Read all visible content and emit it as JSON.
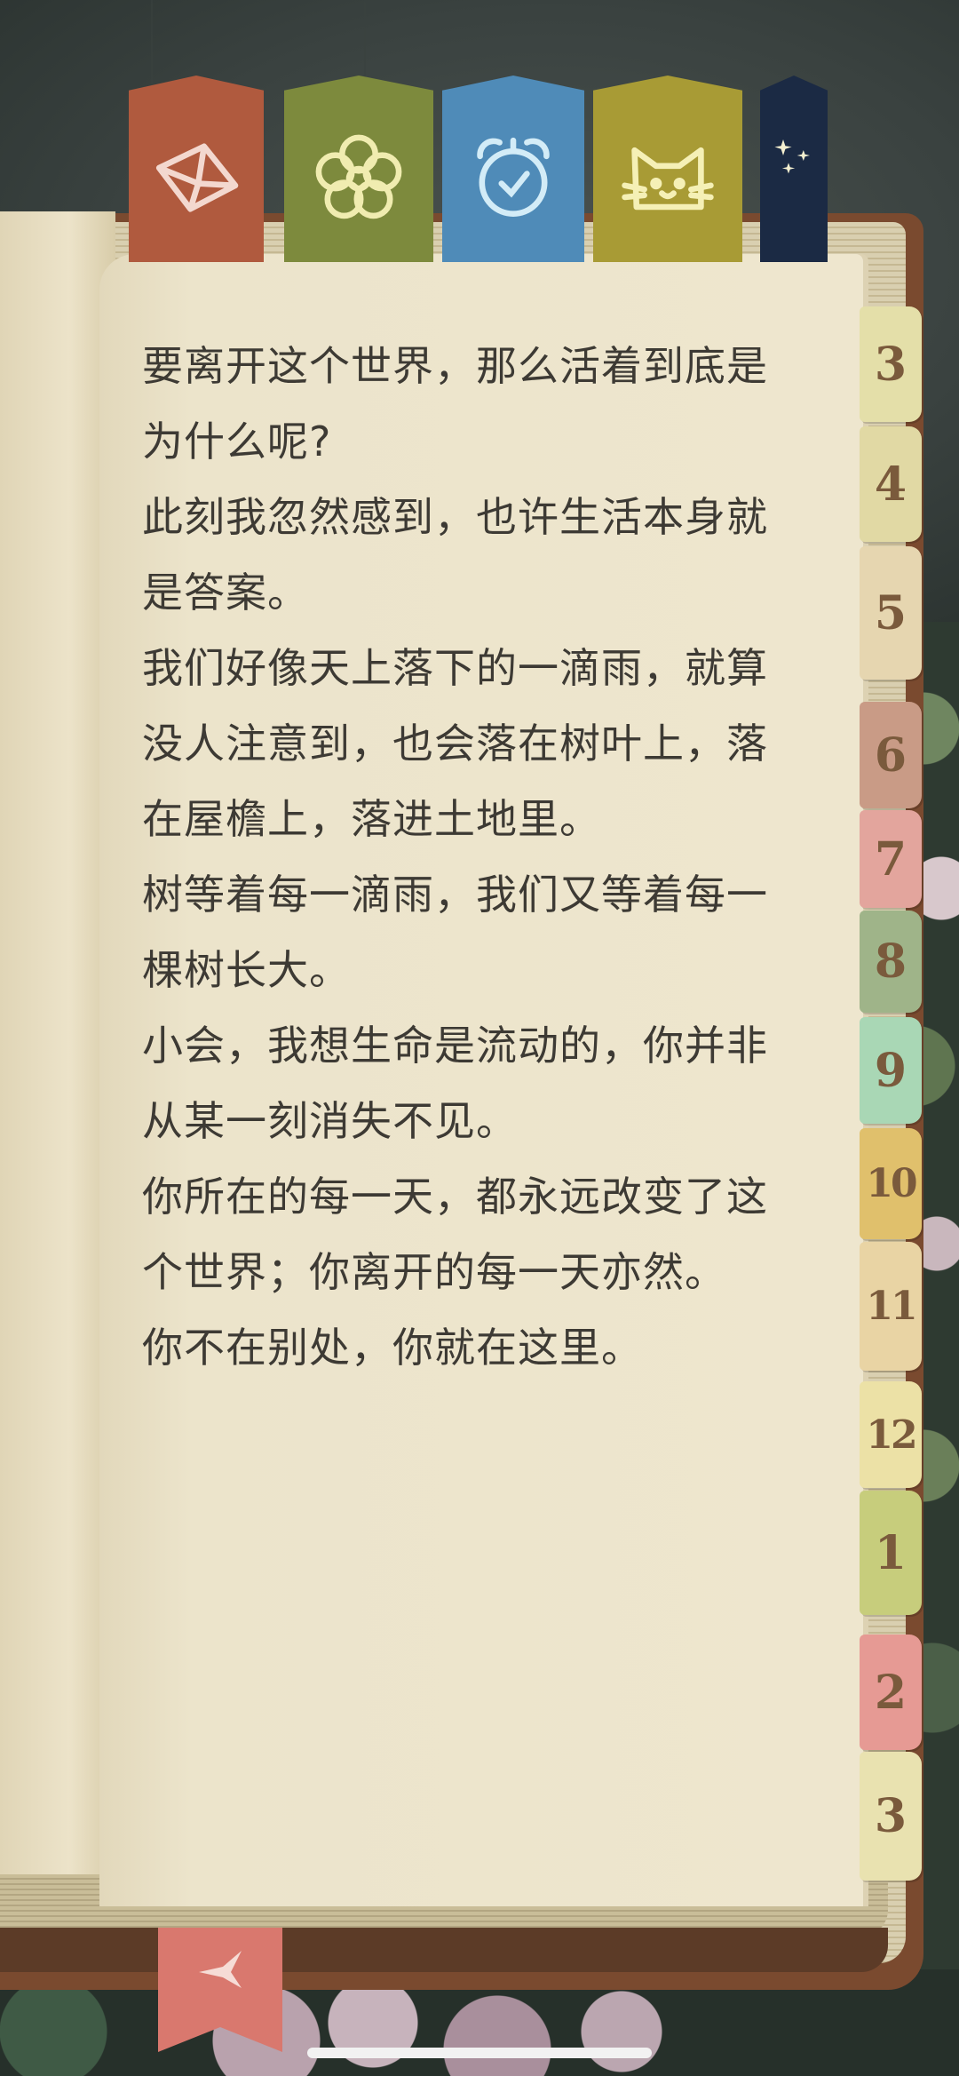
{
  "bookmarks": [
    {
      "name": "mail",
      "icon": "envelope-icon",
      "color": "#b05a3e"
    },
    {
      "name": "flower",
      "icon": "flower-icon",
      "color": "#7d8a3d"
    },
    {
      "name": "clock",
      "icon": "alarm-clock-icon",
      "color": "#4f8bb8"
    },
    {
      "name": "cat",
      "icon": "cat-icon",
      "color": "#a89b35"
    },
    {
      "name": "star",
      "icon": "stars-icon",
      "color": "#1b2a44"
    }
  ],
  "page": {
    "paragraphs": [
      "要离开这个世界，那么活着到底是为什么呢?",
      "此刻我忽然感到，也许生活本身就是答案。",
      "我们好像天上落下的一滴雨，就算没人注意到，也会落在树叶上，落在屋檐上，落进土地里。",
      "树等着每一滴雨，我们又等着每一棵树长大。",
      "小会，我想生命是流动的，你并非从某一刻消失不见。",
      "你所在的每一天，都永远改变了这个世界；你离开的每一天亦然。",
      "你不在别处，你就在这里。"
    ]
  },
  "month_tabs": [
    {
      "label": "3",
      "color": "#e4dfa9"
    },
    {
      "label": "4",
      "color": "#e1d9a4"
    },
    {
      "label": "5",
      "color": "#e6d6b0"
    },
    {
      "label": "6",
      "color": "#c99b86"
    },
    {
      "label": "7",
      "color": "#e3a59d"
    },
    {
      "label": "8",
      "color": "#9fb489"
    },
    {
      "label": "9",
      "color": "#a9d7b5"
    },
    {
      "label": "10",
      "color": "#e0c06c"
    },
    {
      "label": "11",
      "color": "#e9d4a4"
    },
    {
      "label": "12",
      "color": "#ece1a6"
    },
    {
      "label": "1",
      "color": "#c7cd7c"
    },
    {
      "label": "2",
      "color": "#e69a94"
    },
    {
      "label": "3",
      "color": "#e9e2b0"
    }
  ],
  "ribbon": {
    "icon": "bird-icon",
    "color": "#d9786e"
  }
}
